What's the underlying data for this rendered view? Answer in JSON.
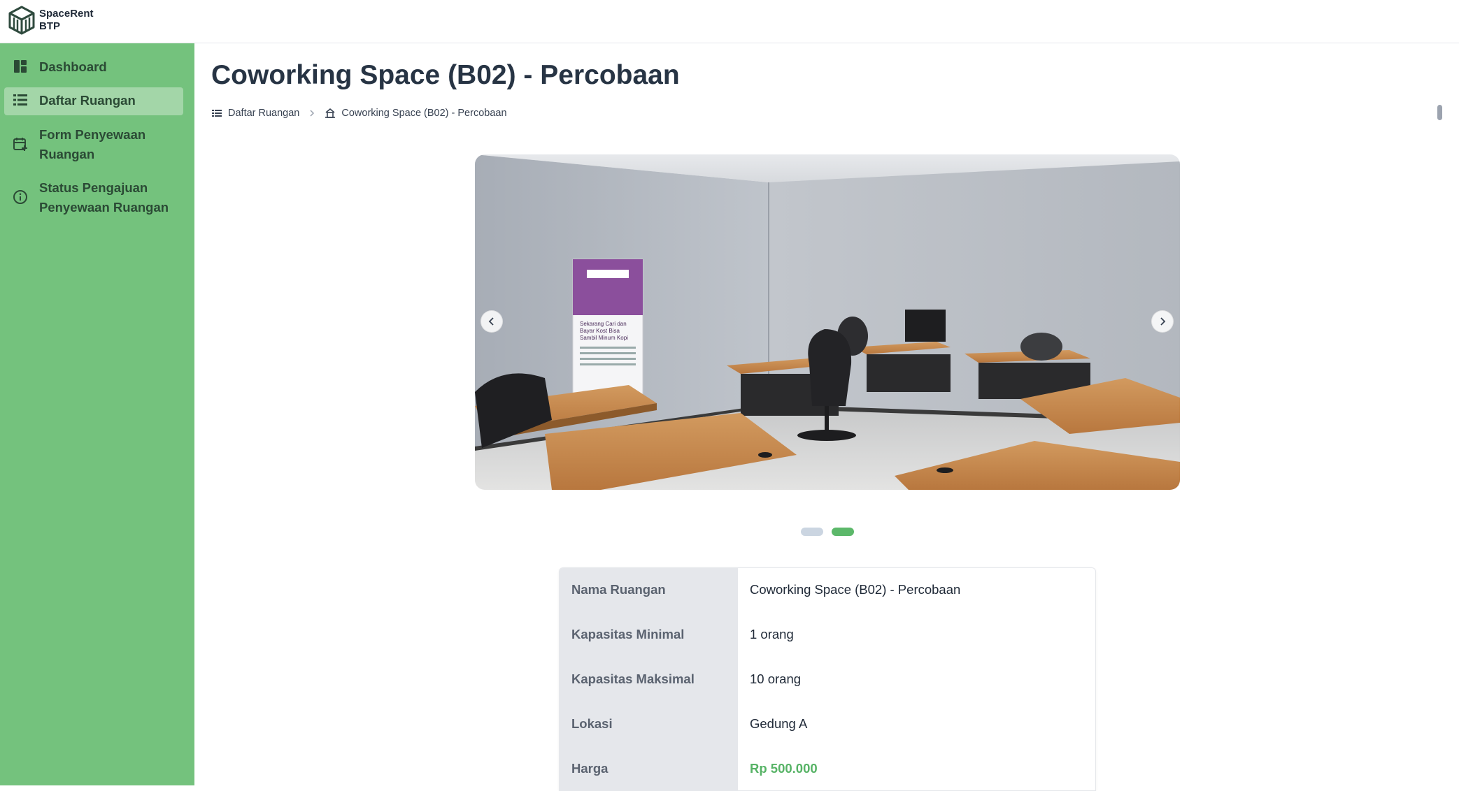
{
  "brand": {
    "line1": "SpaceRent",
    "line2": "BTP"
  },
  "sidebar": {
    "items": [
      {
        "label": "Dashboard",
        "icon": "dashboard-icon",
        "active": false
      },
      {
        "label": "Daftar Ruangan",
        "icon": "list-icon",
        "active": true
      },
      {
        "label": "Form Penyewaan Ruangan",
        "line1": "Form Penyewaan",
        "line2": "Ruangan",
        "icon": "calendar-plus-icon",
        "active": false
      },
      {
        "label": "Status Pengajuan Penyewaan Ruangan",
        "line1": "Status Pengajuan",
        "line2": "Penyewaan Ruangan",
        "icon": "info-circle-icon",
        "active": false
      }
    ]
  },
  "page": {
    "title": "Coworking Space (B02) - Percobaan"
  },
  "breadcrumb": {
    "items": [
      {
        "label": "Daftar Ruangan",
        "icon": "list-icon"
      },
      {
        "label": "Coworking Space (B02) - Percobaan",
        "icon": "building-icon"
      }
    ]
  },
  "carousel": {
    "slide_count": 2,
    "active_index": 1,
    "poster": {
      "line1": "Sekarang Cari dan",
      "line2": "Bayar Kost Bisa",
      "line3": "Sambil Minum Kopi"
    }
  },
  "details": {
    "rows": [
      {
        "key": "Nama Ruangan",
        "value": "Coworking Space (B02) - Percobaan"
      },
      {
        "key": "Kapasitas Minimal",
        "value": "1 orang"
      },
      {
        "key": "Kapasitas Maksimal",
        "value": "10 orang"
      },
      {
        "key": "Lokasi",
        "value": "Gedung A"
      },
      {
        "key": "Harga",
        "value": "Rp 500.000"
      }
    ]
  },
  "colors": {
    "sidebar_bg": "#74c27d",
    "sidebar_active": "#a3d6a8",
    "accent": "#5cb86a",
    "price": "#57b366"
  }
}
